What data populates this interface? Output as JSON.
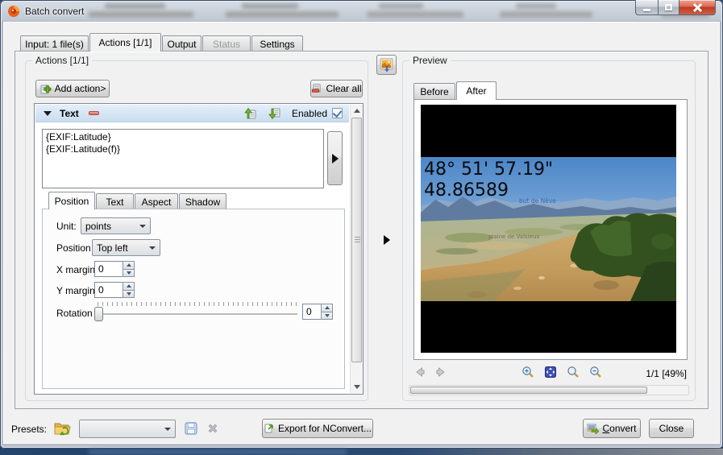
{
  "window": {
    "title": "Batch convert"
  },
  "main_tabs": {
    "input": {
      "label": "Input: 1 file(s)"
    },
    "actions": {
      "label": "Actions [1/1]"
    },
    "output": {
      "label": "Output"
    },
    "status": {
      "label": "Status"
    },
    "settings": {
      "label": "Settings"
    }
  },
  "actions_panel": {
    "title": "Actions [1/1]",
    "add_action": "Add action>",
    "clear_all": "Clear all",
    "action": {
      "title": "Text",
      "enabled_label": "Enabled",
      "enabled": true,
      "text_value": "{EXIF:Latitude}\n{EXIF:Latitude(f)}",
      "tabs": {
        "position": "Position",
        "text": "Text",
        "aspect": "Aspect",
        "shadow": "Shadow"
      },
      "form": {
        "unit_label": "Unit:",
        "unit_value": "points",
        "position_label": "Position",
        "position_value": "Top left",
        "x_margin_label": "X margin",
        "x_margin_value": "0",
        "y_margin_label": "Y margin",
        "y_margin_value": "0",
        "rotation_label": "Rotation",
        "rotation_value": "0"
      }
    }
  },
  "preview_panel": {
    "title": "Preview",
    "before_tab": "Before",
    "after_tab": "After",
    "overlay_line1": "48° 51' 57.19\"",
    "overlay_line2": "48.86589",
    "photo_label_peak": "but de Nève",
    "photo_label_plain": "plaine de Valsieux",
    "page_zoom_indicator": "1/1 [49%]"
  },
  "bottom_bar": {
    "presets_label": "Presets:",
    "preset_value": "",
    "export_button": "Export for NConvert...",
    "convert_button": "Convert",
    "close_button": "Close"
  },
  "icons": {
    "app-icon": "xnconvert-flame",
    "collapse-icon": "down-triangle",
    "remove-action-icon": "red-minus",
    "move-up-icon": "green-arrow-up-page",
    "move-down-icon": "green-arrow-down-page",
    "apply-icon": "right-triangle",
    "splitter-icon": "right-triangle",
    "add-action-icon": "page-green-plus",
    "clear-all-icon": "page-red-minus",
    "show-preview-icon": "picture-refresh",
    "prev-icon": "gray-arrow-left",
    "next-icon": "gray-arrow-right",
    "zoom-in-icon": "magnifier-plus",
    "zoom-fit-icon": "blue-fit-arrows",
    "zoom-100-icon": "magnifier",
    "zoom-out-icon": "magnifier-minus",
    "open-preset-icon": "yellow-folder-green-arrow",
    "save-preset-icon": "blue-floppy",
    "delete-preset-icon": "gray-cross",
    "export-icon": "page-green-arrow",
    "convert-icon": "pictures-green-arrow",
    "minimize-icon": "bar",
    "maximize-icon": "square",
    "close-icon": "cross"
  },
  "colors": {
    "client_bg": "#f1f1f1",
    "action_header_top": "#e4eff9",
    "action_header_bottom": "#c9ddf0",
    "accent_check": "#4a78b8",
    "letterbox": "#000000",
    "sky_top": "#4c86c8",
    "sky_horizon": "#d8e9f6",
    "grass": "#c8a263",
    "trees": "#30491f",
    "overlay_text": "#0a0a0a",
    "map_label_blue": "#2d6bc4"
  }
}
